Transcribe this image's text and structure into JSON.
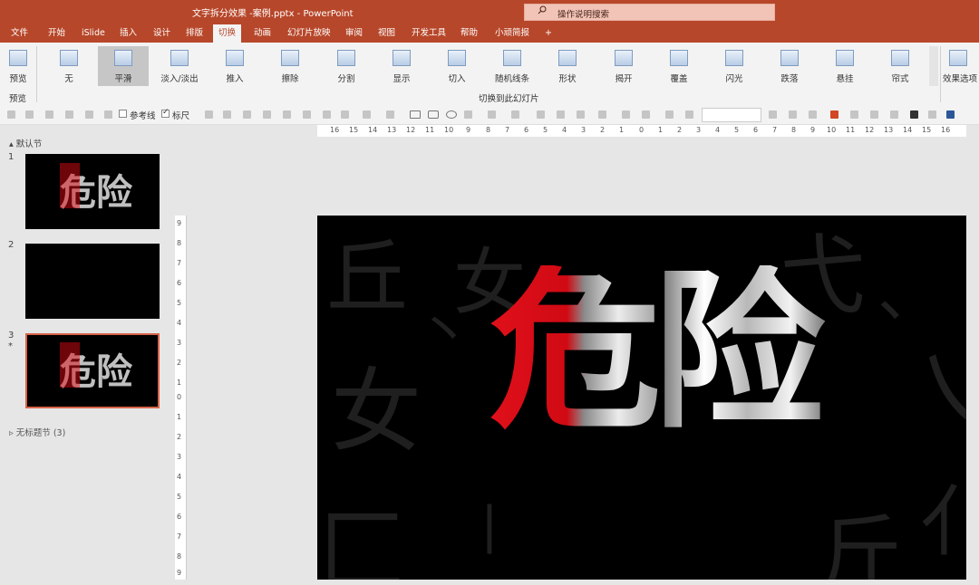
{
  "window": {
    "title": "文字拆分效果 -案例.pptx  -  PowerPoint"
  },
  "search": {
    "placeholder": "操作说明搜索"
  },
  "tabs": [
    "文件",
    "开始",
    "iSlide",
    "插入",
    "设计",
    "排版",
    "切换",
    "动画",
    "幻灯片放映",
    "审阅",
    "视图",
    "开发工具",
    "帮助",
    "小顽简报",
    "+"
  ],
  "active_tab": "切换",
  "ribbon": {
    "preview_label": "预览",
    "preview_group": "预览",
    "transitions_group": "切换到此幻灯片",
    "effect_options": "效果选项",
    "transitions": [
      "无",
      "平滑",
      "淡入/淡出",
      "推入",
      "擦除",
      "分割",
      "显示",
      "切入",
      "随机线条",
      "形状",
      "揭开",
      "覆盖",
      "闪光",
      "跌落",
      "悬挂",
      "帘式"
    ],
    "selected_transition": "平滑"
  },
  "toolbar2": {
    "guides_label": "参考线",
    "ruler_label": "标尺",
    "guides_checked": false,
    "ruler_checked": true
  },
  "sidebar": {
    "section_default": "默认节",
    "section_untitled": "无标题节 (3)",
    "slides": [
      {
        "number": "1",
        "text": "危险",
        "starred": false
      },
      {
        "number": "2",
        "text": "",
        "starred": false
      },
      {
        "number": "3",
        "text": "危险",
        "starred": true
      }
    ]
  },
  "ruler": {
    "h_ticks": [
      "16",
      "15",
      "14",
      "13",
      "12",
      "11",
      "10",
      "9",
      "8",
      "7",
      "6",
      "5",
      "4",
      "3",
      "2",
      "1",
      "0",
      "1",
      "2",
      "3",
      "4",
      "5",
      "6",
      "7",
      "8",
      "9",
      "10",
      "11",
      "12",
      "13",
      "14",
      "15",
      "16"
    ],
    "v_ticks": [
      "9",
      "8",
      "7",
      "6",
      "5",
      "4",
      "3",
      "2",
      "1",
      "0",
      "1",
      "2",
      "3",
      "4",
      "5",
      "6",
      "7",
      "8",
      "9"
    ]
  },
  "slide": {
    "char1": "危",
    "char2": "险",
    "bg_chars": [
      "丘",
      "女",
      "弋",
      "、",
      "乀",
      "女",
      "斤",
      "亻",
      "匚",
      "丶",
      "丨"
    ]
  }
}
